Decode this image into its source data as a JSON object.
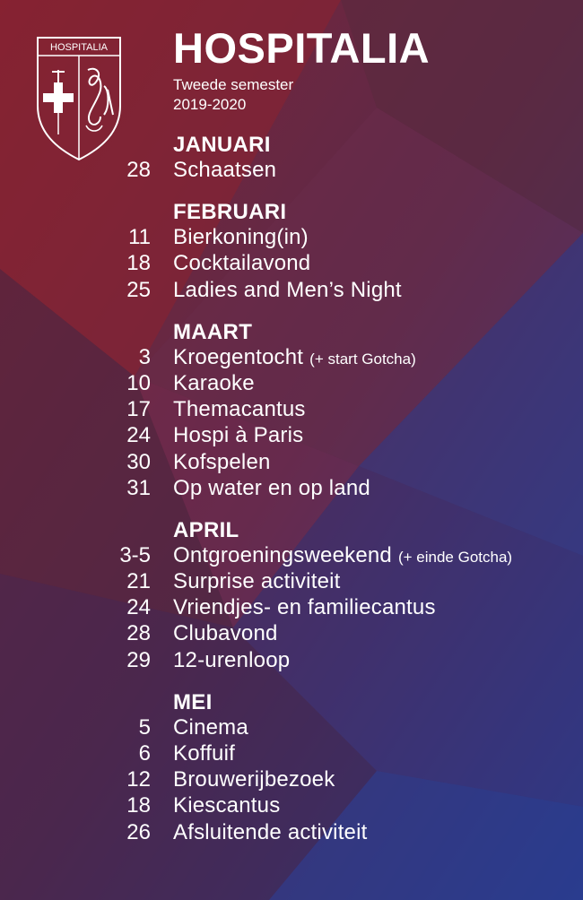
{
  "header": {
    "crest_label": "HOSPITALIA",
    "title": "HOSPITALIA",
    "subtitle_line1": "Tweede semester",
    "subtitle_line2": "2019-2020"
  },
  "colors": {
    "text": "#ffffff",
    "background_primary": "#6b2737",
    "background_secondary": "#2b3c8e"
  },
  "months": [
    {
      "name": "JANUARI",
      "events": [
        {
          "day": "28",
          "name": "Schaatsen",
          "note": ""
        }
      ]
    },
    {
      "name": "FEBRUARI",
      "events": [
        {
          "day": "11",
          "name": "Bierkoning(in)",
          "note": ""
        },
        {
          "day": "18",
          "name": "Cocktailavond",
          "note": ""
        },
        {
          "day": "25",
          "name": "Ladies and Men’s Night",
          "note": ""
        }
      ]
    },
    {
      "name": "MAART",
      "events": [
        {
          "day": "3",
          "name": "Kroegentocht",
          "note": "(+ start Gotcha)"
        },
        {
          "day": "10",
          "name": "Karaoke",
          "note": ""
        },
        {
          "day": "17",
          "name": "Themacantus",
          "note": ""
        },
        {
          "day": "24",
          "name": "Hospi à Paris",
          "note": ""
        },
        {
          "day": "30",
          "name": "Kofspelen",
          "note": ""
        },
        {
          "day": "31",
          "name": "Op water en op land",
          "note": ""
        }
      ]
    },
    {
      "name": "APRIL",
      "events": [
        {
          "day": "3-5",
          "name": "Ontgroeningsweekend",
          "note": "(+ einde Gotcha)"
        },
        {
          "day": "21",
          "name": "Surprise activiteit",
          "note": ""
        },
        {
          "day": "24",
          "name": "Vriendjes- en familiecantus",
          "note": ""
        },
        {
          "day": "28",
          "name": "Clubavond",
          "note": ""
        },
        {
          "day": "29",
          "name": "12-urenloop",
          "note": ""
        }
      ]
    },
    {
      "name": "MEI",
      "events": [
        {
          "day": "5",
          "name": "Cinema",
          "note": ""
        },
        {
          "day": "6",
          "name": "Koffuif",
          "note": ""
        },
        {
          "day": "12",
          "name": "Brouwerijbezoek",
          "note": ""
        },
        {
          "day": "18",
          "name": "Kiescantus",
          "note": ""
        },
        {
          "day": "26",
          "name": "Afsluitende activiteit",
          "note": ""
        }
      ]
    }
  ]
}
